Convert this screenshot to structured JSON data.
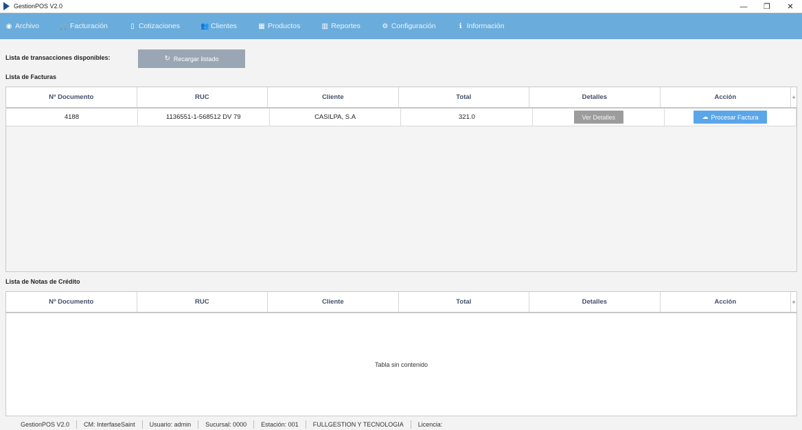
{
  "window": {
    "title": "GestionPOS V2.0",
    "controls": {
      "minimize": "—",
      "restore": "❐",
      "close": "✕"
    }
  },
  "menu": [
    {
      "icon": "dashboard-icon",
      "glyph": "◉",
      "label": "Archivo"
    },
    {
      "icon": "cart-icon",
      "glyph": "🛒",
      "label": "Facturación"
    },
    {
      "icon": "file-icon",
      "glyph": "▯",
      "label": "Cotizaciones"
    },
    {
      "icon": "users-icon",
      "glyph": "👥",
      "label": "Clientes"
    },
    {
      "icon": "grid-icon",
      "glyph": "▦",
      "label": "Productos"
    },
    {
      "icon": "bar-chart-icon",
      "glyph": "▥",
      "label": "Reportes"
    },
    {
      "icon": "gear-icon",
      "glyph": "⚙",
      "label": "Configuración"
    },
    {
      "icon": "info-icon",
      "glyph": "ℹ",
      "label": "Información"
    }
  ],
  "toolbar": {
    "transactions_label": "Lista de transacciones disponibles:",
    "reload_icon": "refresh-icon",
    "reload_label": "Recargar listado"
  },
  "invoices": {
    "section_label": "Lista de Facturas",
    "columns": [
      "Nº Documento",
      "RUC",
      "Cliente",
      "Total",
      "Detalles",
      "Acción"
    ],
    "rows": [
      {
        "documento": "4188",
        "ruc": "1136551-1-568512  DV 79",
        "cliente": "CASILPA, S.A",
        "total": "321.0",
        "details_button": "Ver Detalles",
        "action_button": "Procesar Factura",
        "action_icon": "cloud-upload-icon"
      }
    ]
  },
  "credit_notes": {
    "section_label": "Lista de Notas de Crédito",
    "columns": [
      "Nº Documento",
      "RUC",
      "Cliente",
      "Total",
      "Detalles",
      "Acción"
    ],
    "empty_message": "Tabla sin contenido"
  },
  "column_menu_glyph": "+",
  "status": [
    "GestionPOS V2.0",
    "CM: InterfaseSaint",
    "Usuario: admin",
    "Sucursal: 0000",
    "Estación: 001",
    "FULLGESTION Y TECNOLOGIA",
    "Licencia:"
  ],
  "colors": {
    "menubar": "#6aacdc",
    "primary_button": "#5aa6e8",
    "secondary_button": "#9c9c9c",
    "reload_button": "#9aa6b4"
  }
}
